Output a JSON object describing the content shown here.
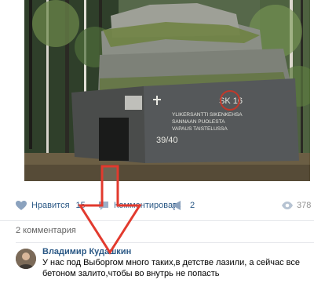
{
  "post": {
    "photo_text": {
      "line1": "YLIKERSANTTI SIKENKEHSA",
      "line2": "SANNAAN PUOLESTA",
      "line3": "VAPAUS TAISTELUSSA",
      "number": "39/40",
      "mark": "SK 16"
    }
  },
  "actions": {
    "like_label": "Нравится",
    "like_count": "15",
    "comment_label": "Комментировать",
    "share_count": "2",
    "views_count": "378"
  },
  "comments": {
    "count_label": "2 комментария",
    "items": [
      {
        "author": "Владимир Кудашкин",
        "text": "У нас под Выборгом много таких,в детстве лазили, а сейчас все бетоном залито,чтобы во внутрь не попасть"
      }
    ]
  },
  "icons": {
    "like": "heart-icon",
    "comment": "comment-icon",
    "share": "megaphone-icon",
    "views": "eye-icon"
  },
  "colors": {
    "link": "#2a5885",
    "arrow": "#e23a2e",
    "muted": "#656565"
  }
}
